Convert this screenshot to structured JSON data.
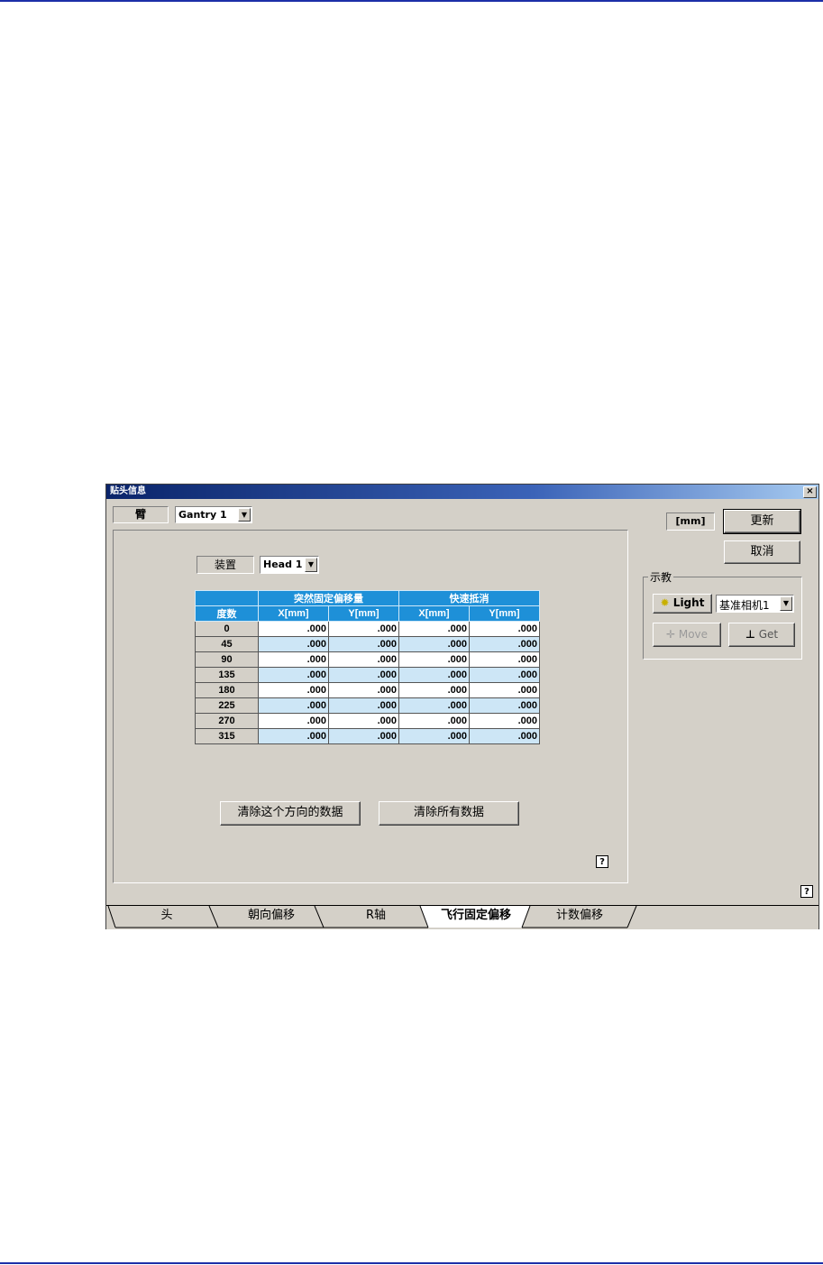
{
  "window": {
    "title": "贴头信息",
    "close_label": "×",
    "arm_label": "臂",
    "arm_value": "Gantry 1",
    "unit_label": "[mm]",
    "update_button": "更新",
    "cancel_button": "取消",
    "help_label": "?"
  },
  "panel": {
    "device_label": "装置",
    "device_value": "Head 1",
    "table": {
      "group_headers": [
        "突然固定偏移量",
        "快速抵消"
      ],
      "columns": [
        "度数",
        "X[mm]",
        "Y[mm]",
        "X[mm]",
        "Y[mm]"
      ],
      "rows": [
        [
          "0",
          ".000",
          ".000",
          ".000",
          ".000"
        ],
        [
          "45",
          ".000",
          ".000",
          ".000",
          ".000"
        ],
        [
          "90",
          ".000",
          ".000",
          ".000",
          ".000"
        ],
        [
          "135",
          ".000",
          ".000",
          ".000",
          ".000"
        ],
        [
          "180",
          ".000",
          ".000",
          ".000",
          ".000"
        ],
        [
          "225",
          ".000",
          ".000",
          ".000",
          ".000"
        ],
        [
          "270",
          ".000",
          ".000",
          ".000",
          ".000"
        ],
        [
          "315",
          ".000",
          ".000",
          ".000",
          ".000"
        ]
      ]
    },
    "clear_direction_button": "清除这个方向的数据",
    "clear_all_button": "清除所有数据",
    "help_label": "?"
  },
  "teach": {
    "group_label": "示教",
    "light_button": "Light",
    "camera_value": "基准相机1",
    "move_button": "Move",
    "get_button": "Get"
  },
  "tabs": [
    {
      "label": "头",
      "active": false
    },
    {
      "label": "朝向偏移",
      "active": false
    },
    {
      "label": "R轴",
      "active": false
    },
    {
      "label": "飞行固定偏移",
      "active": true
    },
    {
      "label": "计数偏移",
      "active": false
    }
  ],
  "colors": {
    "title_bar": "#0a246a",
    "table_header": "#1e90d8",
    "row_alt": "#cde6f6",
    "dialog_face": "#d4d0c8"
  }
}
